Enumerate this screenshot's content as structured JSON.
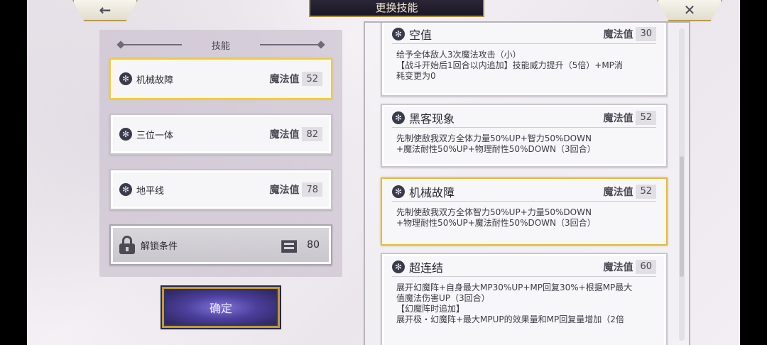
{
  "header": {
    "title": "更换技能",
    "back_label": "←",
    "close_label": "✕"
  },
  "panel": {
    "title": "技能",
    "slots": [
      {
        "name": "机械故障",
        "mp_label": "魔法值",
        "mp": "52"
      },
      {
        "name": "三位一体",
        "mp_label": "魔法值",
        "mp": "82"
      },
      {
        "name": "地平线",
        "mp_label": "魔法值",
        "mp": "78"
      }
    ],
    "locked": {
      "name": "解锁条件",
      "cost": "80"
    }
  },
  "confirm_label": "确定",
  "skills": [
    {
      "name": "空值",
      "mp_label": "魔法值",
      "mp": "30",
      "desc": "给予全体敌人3次魔法攻击（小）\n【战斗开始后1回合以内追加】技能威力提升（5倍）+MP消\n耗变更为0"
    },
    {
      "name": "黑客现象",
      "mp_label": "魔法值",
      "mp": "52",
      "desc": "先制使敌我双方全体力量50%UP+智力50%DOWN\n+魔法耐性50%UP+物理耐性50%DOWN（3回合）"
    },
    {
      "name": "机械故障",
      "mp_label": "魔法值",
      "mp": "52",
      "desc": "先制使敌我双方全体智力50%UP+力量50%DOWN\n+物理耐性50%UP+魔法耐性50%DOWN（3回合）"
    },
    {
      "name": "超连结",
      "mp_label": "魔法值",
      "mp": "60",
      "desc": "展开幻魔阵+自身最大MP30%UP+MP回复30%+根据MP最大\n值魔法伤害UP（3回合）\n【幻魔阵时追加】\n展开极・幻魔阵+最大MPUP的效果量和MP回复量增加（2倍"
    }
  ],
  "colors": {
    "gold": "#d8b85a",
    "confirm": "#4b3f9c",
    "title_bar": "#2b2637"
  },
  "icons": {
    "skill": "snowflake-gear-icon",
    "lock": "padlock-icon",
    "cost": "card-stack-icon"
  }
}
